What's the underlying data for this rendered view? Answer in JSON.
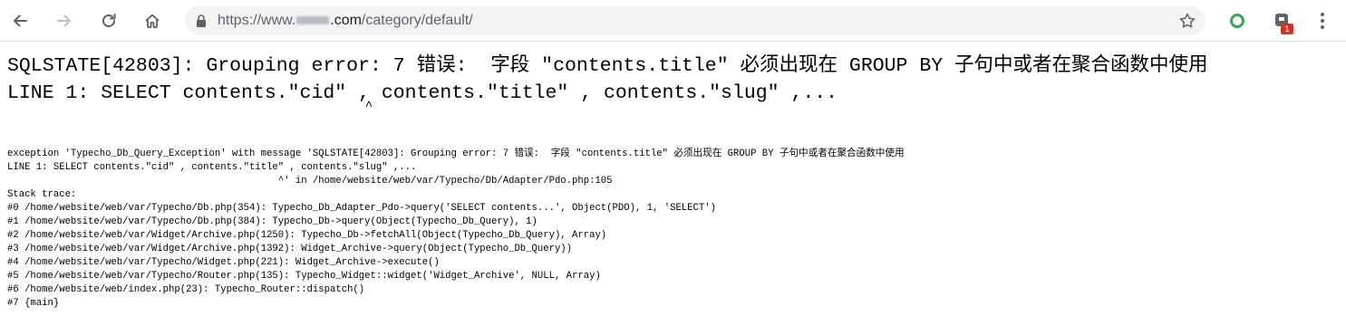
{
  "browser": {
    "url_scheme": "https://www.",
    "url_host_suffix": ".com",
    "url_path": "/category/default/",
    "extension_badge": "1",
    "icons": [
      "back-arrow-icon",
      "forward-arrow-icon",
      "reload-icon",
      "home-icon",
      "lock-icon",
      "star-icon",
      "extension-icon",
      "extension-icon",
      "menu-icon"
    ]
  },
  "error": {
    "heading_line1": "SQLSTATE[42803]: Grouping error: 7 错误:  字段 \"contents.title\" 必须出现在 GROUP BY 子句中或者在聚合函数中使用",
    "heading_line2": "LINE 1: SELECT contents.\"cid\" , contents.\"title\" , contents.\"slug\" ,...",
    "heading_caret": "                                               ^",
    "exception_line1": "exception 'Typecho_Db_Query_Exception' with message 'SQLSTATE[42803]: Grouping error: 7 错误:  字段 \"contents.title\" 必须出现在 GROUP BY 子句中或者在聚合函数中使用",
    "exception_line2": "LINE 1: SELECT contents.\"cid\" , contents.\"title\" , contents.\"slug\" ,...",
    "exception_line3": "                                               ^' in /home/website/web/var/Typecho/Db/Adapter/Pdo.php:105",
    "stack_label": "Stack trace:",
    "stack": [
      "#0 /home/website/web/var/Typecho/Db.php(354): Typecho_Db_Adapter_Pdo->query('SELECT contents...', Object(PDO), 1, 'SELECT')",
      "#1 /home/website/web/var/Typecho/Db.php(384): Typecho_Db->query(Object(Typecho_Db_Query), 1)",
      "#2 /home/website/web/var/Widget/Archive.php(1250): Typecho_Db->fetchAll(Object(Typecho_Db_Query), Array)",
      "#3 /home/website/web/var/Widget/Archive.php(1392): Widget_Archive->query(Object(Typecho_Db_Query))",
      "#4 /home/website/web/var/Typecho/Widget.php(221): Widget_Archive->execute()",
      "#5 /home/website/web/var/Typecho/Router.php(135): Typecho_Widget::widget('Widget_Archive', NULL, Array)",
      "#6 /home/website/web/index.php(23): Typecho_Router::dispatch()",
      "#7 {main}"
    ]
  },
  "colors": {
    "toolbar_icon": "#5f6368",
    "toolbar_icon_disabled": "#bdc1c6",
    "ext_green": "#34a853",
    "badge_red": "#d93025"
  }
}
